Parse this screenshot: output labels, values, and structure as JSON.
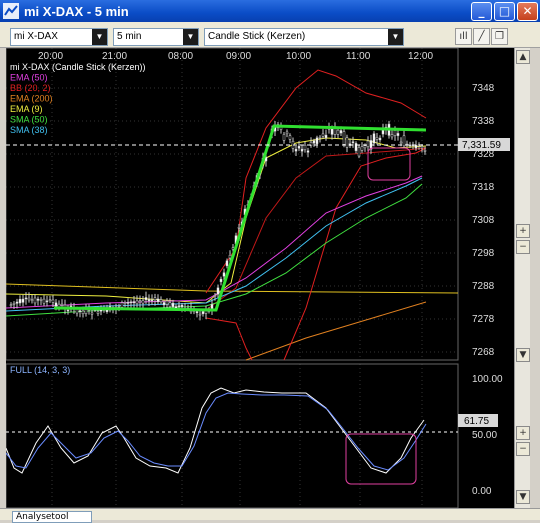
{
  "window": {
    "title": "mi X-DAX - 5 min",
    "min_label": "_",
    "max_label": "□",
    "close_label": "✕"
  },
  "toolbar": {
    "instrument": "mi X-DAX",
    "interval": "5 min",
    "chart_type": "Candle Stick (Kerzen)"
  },
  "main_chart": {
    "time_labels": [
      "20:00",
      "21:00",
      "08:00",
      "09:00",
      "10:00",
      "11:00",
      "12:00"
    ],
    "price_labels": [
      "7348",
      "7338",
      "7328",
      "7318",
      "7308",
      "7298",
      "7288",
      "7278",
      "7268"
    ],
    "current_price": "7,331.59",
    "legend": [
      {
        "text": "mi X-DAX (Candle Stick (Kerzen))",
        "color": "#ffffff"
      },
      {
        "text": "EMA (50)",
        "color": "#e040e0"
      },
      {
        "text": "BB (20, 2)",
        "color": "#e02020"
      },
      {
        "text": "EMA (200)",
        "color": "#e08020"
      },
      {
        "text": "EMA (9)",
        "color": "#f0f040"
      },
      {
        "text": "SMA (50)",
        "color": "#40e040"
      },
      {
        "text": "SMA (38)",
        "color": "#40c0f0"
      }
    ]
  },
  "oscillator": {
    "label": "FULL (14, 3, 3)",
    "levels": [
      "100.00",
      "50.00",
      "0.00"
    ],
    "current_value": "61.75"
  },
  "bottom": {
    "combo_label": "Analysetool"
  },
  "colors": {
    "chart_bg": "#000000",
    "trend_line": "#30e030",
    "highlight_box": "#e040a0",
    "title_bar": "#0a4cc6"
  }
}
